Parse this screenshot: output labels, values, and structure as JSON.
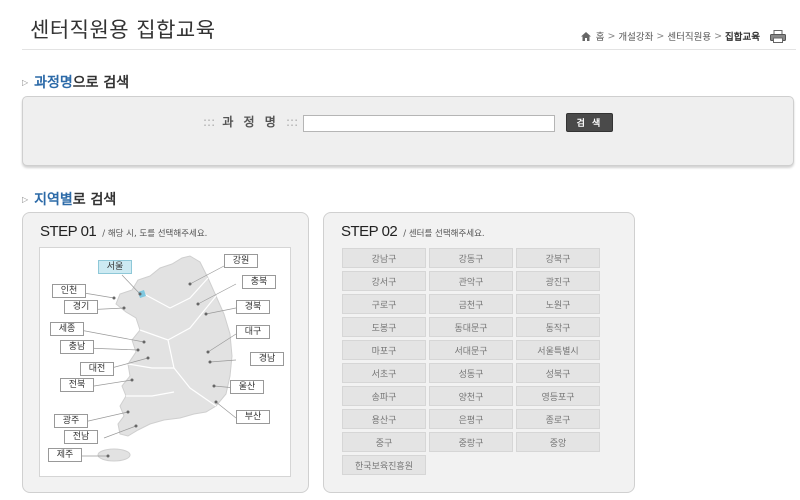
{
  "header": {
    "title": "센터직원용 집합교육",
    "breadcrumb": [
      "홈",
      "개설강좌",
      "센터직원용",
      "집합교육"
    ],
    "breadcrumb_sep": ">"
  },
  "course_search": {
    "heading_highlight": "과정명",
    "heading_rest": "으로 검색",
    "label_dots_left": ":::",
    "label": "과 정 명",
    "label_dots_right": ":::",
    "input_value": "",
    "button_label": "검 색"
  },
  "region_search": {
    "heading_highlight": "지역별",
    "heading_rest": "로 검색",
    "step1": {
      "no": "STEP 01",
      "desc": "/  해당 시, 도를 선택해주세요.",
      "regions": [
        {
          "id": "seoul",
          "label": "서울",
          "active": true
        },
        {
          "id": "gangwon",
          "label": "강원",
          "active": false
        },
        {
          "id": "incheon",
          "label": "인천",
          "active": false
        },
        {
          "id": "chungbuk",
          "label": "충북",
          "active": false
        },
        {
          "id": "gyeonggi",
          "label": "경기",
          "active": false
        },
        {
          "id": "gyeongbuk",
          "label": "경북",
          "active": false
        },
        {
          "id": "sejong",
          "label": "세종",
          "active": false
        },
        {
          "id": "daegu",
          "label": "대구",
          "active": false
        },
        {
          "id": "chungnam",
          "label": "충남",
          "active": false
        },
        {
          "id": "gyeongnam",
          "label": "경남",
          "active": false
        },
        {
          "id": "daejeon",
          "label": "대전",
          "active": false
        },
        {
          "id": "jeonbuk",
          "label": "전북",
          "active": false
        },
        {
          "id": "ulsan",
          "label": "울산",
          "active": false
        },
        {
          "id": "busan",
          "label": "부산",
          "active": false
        },
        {
          "id": "gwangju",
          "label": "광주",
          "active": false
        },
        {
          "id": "jeonnam",
          "label": "전남",
          "active": false
        },
        {
          "id": "jeju",
          "label": "제주",
          "active": false
        }
      ]
    },
    "step2": {
      "no": "STEP 02",
      "desc": "/  센터를 선택해주세요.",
      "centers": [
        "강남구",
        "강동구",
        "강북구",
        "강서구",
        "관악구",
        "광진구",
        "구로구",
        "금천구",
        "노원구",
        "도봉구",
        "동대문구",
        "동작구",
        "마포구",
        "서대문구",
        "서울특별시",
        "서초구",
        "성동구",
        "성북구",
        "송파구",
        "양천구",
        "영등포구",
        "용산구",
        "은평구",
        "종로구",
        "중구",
        "중랑구",
        "중앙",
        "한국보육진흥원"
      ]
    }
  },
  "icons": {
    "home": "home-icon",
    "print": "printer-icon",
    "bullet": "triangle-bullet-icon"
  },
  "colors": {
    "accent": "#2c6aa8",
    "active_region": "#cdeaf2",
    "button_dark": "#4a4a4a"
  }
}
